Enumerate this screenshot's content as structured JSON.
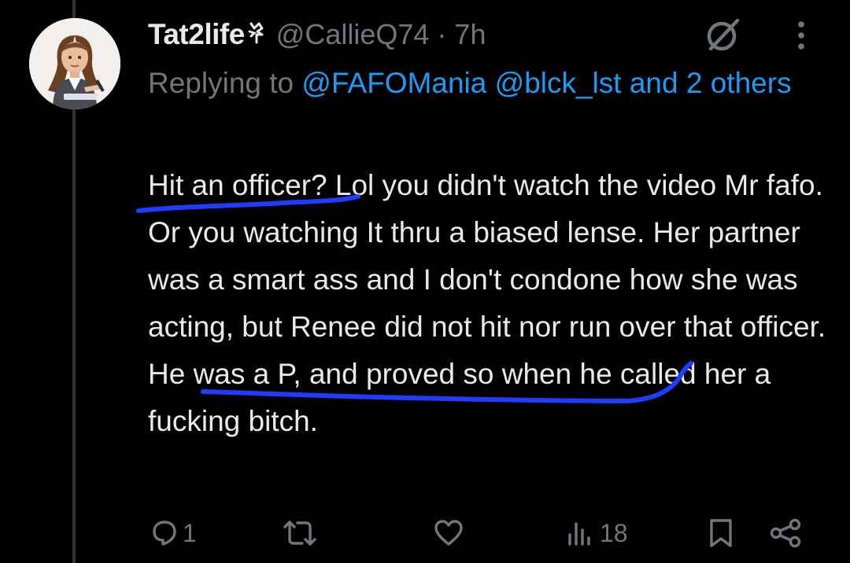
{
  "tweet": {
    "display_name": "Tat2life",
    "handle": "@CallieQ74",
    "separator": "·",
    "time": "7h",
    "reply_prefix": "Replying to ",
    "reply_mention_1": "@FAFOMania",
    "reply_mention_2": "@blck_lst",
    "reply_and_others": "and 2 others",
    "body": "Hit an officer? Lol you didn't watch the video Mr fafo. Or you watching It thru a biased lense. Her partner was a smart ass and I don't condone how she was acting, but Renee did not hit nor run over that officer. He was a P, and proved so when he called her a fucking bitch."
  },
  "actions": {
    "reply_count": "1",
    "retweet_count": "",
    "like_count": "",
    "views_count": "18"
  },
  "icons": {
    "badge": "flower-emoji-icon",
    "grok": "grok-icon",
    "more": "more-vertical-icon",
    "reply": "reply-icon",
    "retweet": "retweet-icon",
    "like": "heart-icon",
    "views": "views-chart-icon",
    "bookmark": "bookmark-icon",
    "share": "share-icon"
  },
  "colors": {
    "background": "#000000",
    "text": "#e7e9ea",
    "muted": "#71767b",
    "accent": "#1d9bf0",
    "annotation": "#1f3cff"
  }
}
